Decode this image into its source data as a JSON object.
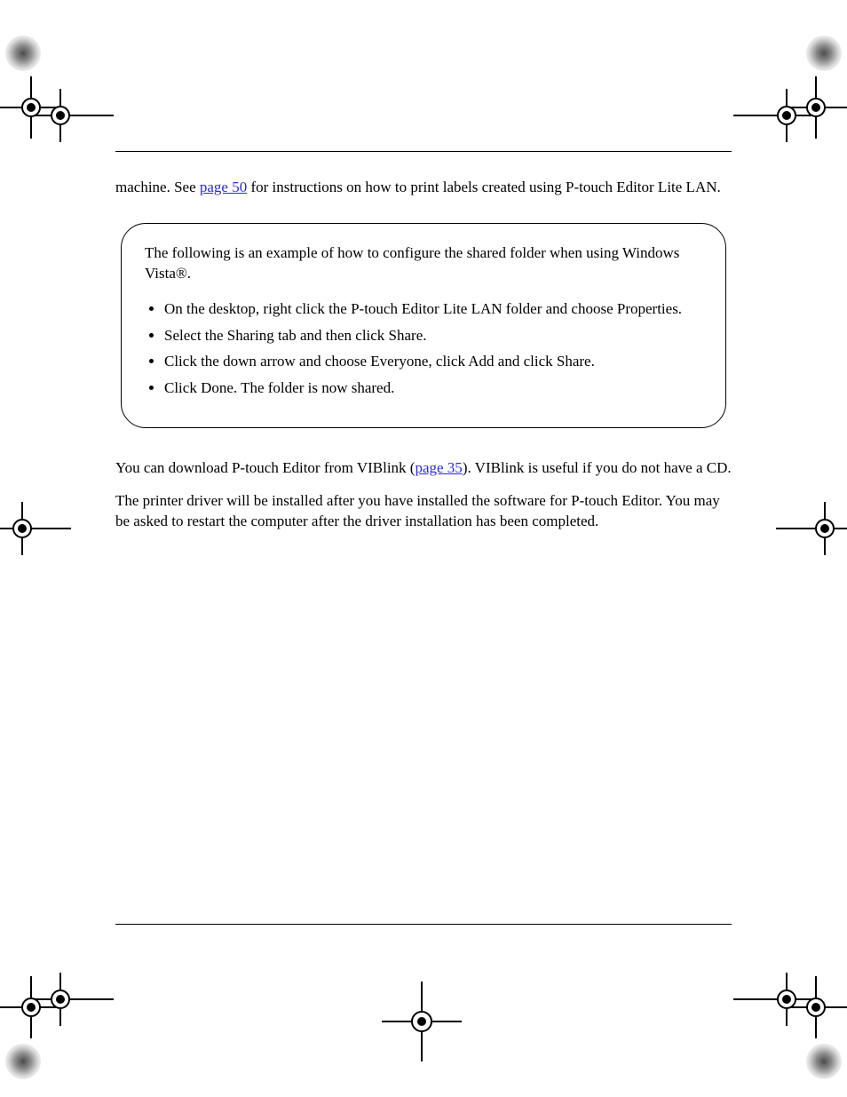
{
  "header": {
    "line1_prefix": "machine. See ",
    "line1_link": "page 50",
    "line1_suffix": " for instructions on how to",
    "line2": "print labels created using P-touch Editor Lite LAN."
  },
  "box": {
    "intro": "The following is an example of how to configure the shared folder when using Windows Vista®.",
    "steps": [
      "On the desktop, right click the P-touch Editor Lite LAN folder and choose Properties.",
      "Select the Sharing tab and then click Share.",
      "Click the down arrow and choose Everyone, click Add and click Share.",
      "Click Done. The folder is now shared."
    ]
  },
  "para2": {
    "prefix": "You can download P-touch Editor from VIBlink (",
    "link": "page 35",
    "suffix": "). VIBlink is useful if you do not have a CD."
  },
  "para3": "The printer driver will be installed after you have installed the software for P-touch Editor. You may be asked to restart the computer after the driver installation has been completed."
}
